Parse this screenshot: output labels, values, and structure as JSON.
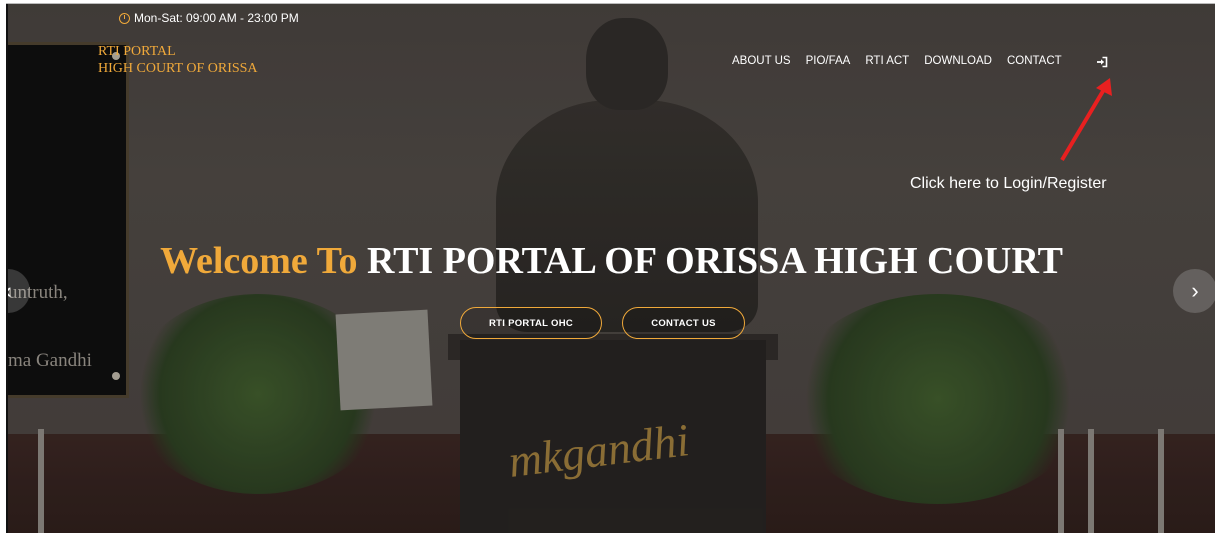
{
  "topbar": {
    "hours": "Mon-Sat: 09:00 AM - 23:00 PM"
  },
  "brand": {
    "line1": "RTI PORTAL",
    "line2": "HIGH COURT OF ORISSA"
  },
  "nav": {
    "items": [
      "ABOUT US",
      "PIO/FAA",
      "RTI ACT",
      "DOWNLOAD",
      "CONTACT"
    ],
    "login_icon": "sign-in-icon"
  },
  "annotation": {
    "text": "Click here to Login/Register"
  },
  "hero": {
    "accent": "Welcome To",
    "title": "RTI PORTAL OF ORISSA HIGH COURT",
    "btn_primary": "RTI PORTAL OHC",
    "btn_secondary": "CONTACT US"
  },
  "background": {
    "board_line1": "untruth,",
    "board_line2": "ma Gandhi",
    "signature": "mkgandhi"
  },
  "colors": {
    "accent": "#f0a93a",
    "arrow": "#e82020"
  }
}
